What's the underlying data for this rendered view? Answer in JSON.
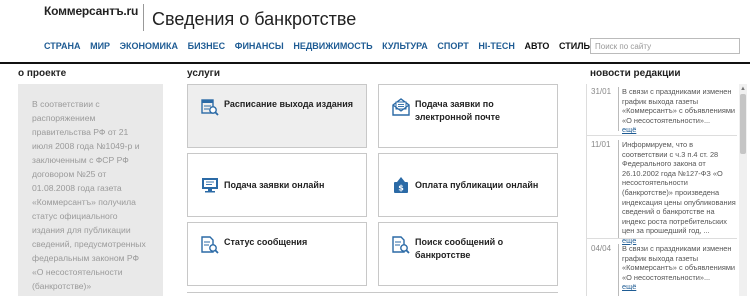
{
  "header": {
    "logo": "Коммерсантъ.ru",
    "title": "Сведения о банкротстве"
  },
  "nav": {
    "items": [
      "СТРАНА",
      "МИР",
      "ЭКОНОМИКА",
      "БИЗНЕС",
      "ФИНАНСЫ",
      "НЕДВИЖИМОСТЬ",
      "КУЛЬТУРА",
      "СПОРТ",
      "HI-TECH",
      "АВТО",
      "СТИЛЬ"
    ],
    "search_placeholder": "Поиск по сайту"
  },
  "about": {
    "heading": "о проекте",
    "text": "В соответствии с распоряжением правительства РФ от 21 июля 2008 года №1049-р и заключенным с ФСР РФ договором №25 от 01.08.2008 года газета «Коммерсантъ» получила статус официального издания для публикации сведений, предусмотренных федеральным законом РФ «О несостоятельности (банкротстве)»"
  },
  "services": {
    "heading": "услуги",
    "tiles": [
      {
        "label": "Расписание выхода издания",
        "icon": "calendar-search-icon"
      },
      {
        "label": "Подача заявки по электронной почте",
        "icon": "email-icon"
      },
      {
        "label": "Подача заявки онлайн",
        "icon": "monitor-icon"
      },
      {
        "label": "Оплата публикации онлайн",
        "icon": "payment-icon"
      },
      {
        "label": "Статус сообщения",
        "icon": "document-search-icon"
      },
      {
        "label": "Поиск сообщений о банкротстве",
        "icon": "document-search-icon"
      }
    ]
  },
  "news": {
    "heading": "новости редакции",
    "more_label": "ещё",
    "items": [
      {
        "date": "31/01",
        "text": "В связи с праздниками изменен график выхода газеты «Коммерсантъ» с объявлениями «О несостоятельности»..."
      },
      {
        "date": "11/01",
        "text": "Информируем, что в соответствии с ч.3 п.4 ст. 28 Федерального закона от 26.10.2002 года №127-ФЗ «О несостоятельности (банкротстве)» произведена индексация цены опубликования сведений о банкротстве на индекс роста потребительских цен за прошедший год, ..."
      },
      {
        "date": "04/04",
        "text": "В связи с праздниками изменен график выхода газеты «Коммерсантъ» с объявлениями «О несостоятельности»..."
      }
    ]
  },
  "colors": {
    "nav_link": "#1f5c94",
    "about_bg": "#e9e9e9",
    "about_text": "#9a9a9a",
    "icon_blue": "#2b6aa6"
  }
}
